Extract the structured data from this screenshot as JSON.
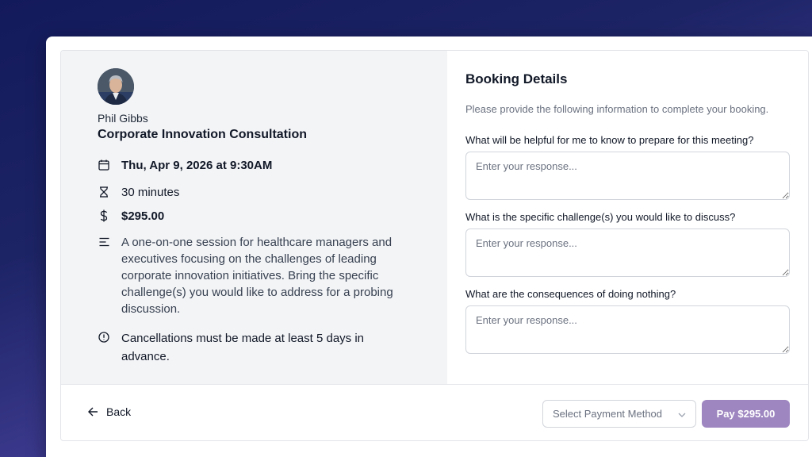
{
  "host": {
    "name": "Phil Gibbs"
  },
  "event": {
    "title": "Corporate Innovation Consultation",
    "datetime": "Thu, Apr 9, 2026 at 9:30AM",
    "duration": "30 minutes",
    "price": "$295.00",
    "description": "A one-on-one session for healthcare managers and executives focusing on the challenges of leading corporate innovation initiatives. Bring the specific challenge(s) you would like to address for a probing discussion.",
    "cancellation": "Cancellations must be made at least 5 days in advance."
  },
  "icons": {
    "date": "calendar-icon",
    "duration": "hourglass-icon",
    "price": "dollar-icon",
    "description": "text-lines-icon",
    "cancellation": "info-circle-icon"
  },
  "booking": {
    "title": "Booking Details",
    "subtitle": "Please provide the following information to complete your booking.",
    "questions": [
      {
        "label": "What will be helpful for me to know to prepare for this meeting?",
        "placeholder": "Enter your response...",
        "value": ""
      },
      {
        "label": "What is the specific challenge(s) you would like to discuss?",
        "placeholder": "Enter your response...",
        "value": ""
      },
      {
        "label": "What are the consequences of doing nothing?",
        "placeholder": "Enter your response...",
        "value": ""
      }
    ]
  },
  "footer": {
    "back_label": "Back",
    "payment_method_placeholder": "Select Payment Method",
    "pay_label": "Pay $295.00"
  },
  "colors": {
    "pay_button": "#9e86c0",
    "left_pane_bg": "#f3f4f6",
    "background_top": "#131a5c",
    "background_bottom": "#6a55ae"
  }
}
